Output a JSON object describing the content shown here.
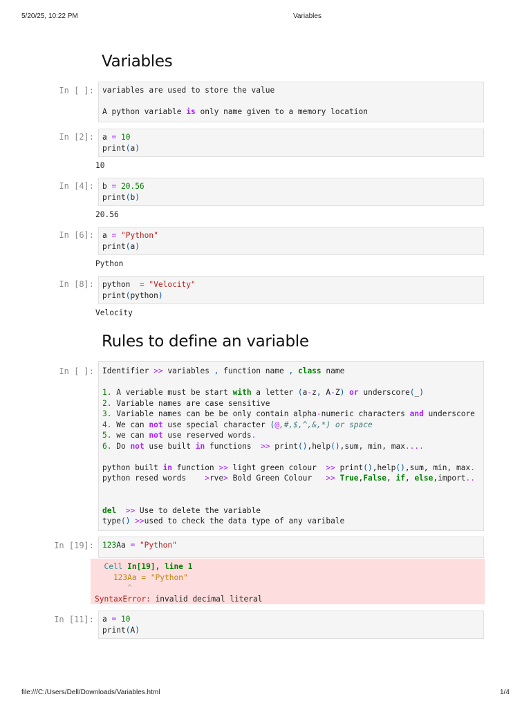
{
  "print_header": {
    "datetime": "5/20/25, 10:22 PM",
    "title": "Variables"
  },
  "print_footer": {
    "path": "file:///C:/Users/Dell/Downloads/Variables.html",
    "page": "1/4"
  },
  "headings": [
    "Variables",
    "Rules to define an variable"
  ],
  "cells": [
    {
      "prompt": "In [ ]:",
      "lines": [
        [
          [
            "variables are used to store the value",
            ""
          ]
        ],
        [],
        [
          [
            "A python variable ",
            ""
          ],
          [
            "is",
            "ob"
          ],
          [
            " only name given to a memory location",
            ""
          ]
        ]
      ]
    },
    {
      "prompt": "In [2]:",
      "lines": [
        [
          [
            "a ",
            ""
          ],
          [
            "=",
            "o"
          ],
          [
            " ",
            ""
          ],
          [
            "10",
            "n"
          ]
        ],
        [
          [
            "print",
            ""
          ],
          [
            "(",
            "p"
          ],
          [
            "a",
            ""
          ],
          [
            ")",
            "p"
          ]
        ]
      ],
      "output": "10"
    },
    {
      "prompt": "In [4]:",
      "lines": [
        [
          [
            "b ",
            ""
          ],
          [
            "=",
            "o"
          ],
          [
            " ",
            ""
          ],
          [
            "20.56",
            "n"
          ]
        ],
        [
          [
            "print",
            ""
          ],
          [
            "(",
            "p"
          ],
          [
            "b",
            ""
          ],
          [
            ")",
            "p"
          ]
        ]
      ],
      "output": "20.56"
    },
    {
      "prompt": "In [6]:",
      "lines": [
        [
          [
            "a ",
            ""
          ],
          [
            "=",
            "o"
          ],
          [
            " ",
            ""
          ],
          [
            "\"Python\"",
            "s"
          ]
        ],
        [
          [
            "print",
            ""
          ],
          [
            "(",
            "p"
          ],
          [
            "a",
            ""
          ],
          [
            ")",
            "p"
          ]
        ]
      ],
      "output": "Python"
    },
    {
      "prompt": "In [8]:",
      "lines": [
        [
          [
            "python  ",
            ""
          ],
          [
            "=",
            "o"
          ],
          [
            " ",
            ""
          ],
          [
            "\"Velocity\"",
            "s"
          ]
        ],
        [
          [
            "print",
            ""
          ],
          [
            "(",
            "p"
          ],
          [
            "python",
            ""
          ],
          [
            ")",
            "p"
          ]
        ]
      ],
      "output": "Velocity"
    },
    {
      "prompt": "In [ ]:",
      "lines": [
        [
          [
            "Identifier ",
            ""
          ],
          [
            ">>",
            "o"
          ],
          [
            " variables ",
            ""
          ],
          [
            ",",
            "p"
          ],
          [
            " function name ",
            ""
          ],
          [
            ",",
            "p"
          ],
          [
            " ",
            ""
          ],
          [
            "class",
            "k"
          ],
          [
            " name",
            ""
          ]
        ],
        [],
        [
          [
            "1.",
            "n"
          ],
          [
            " A veriable must be start ",
            ""
          ],
          [
            "with",
            "k"
          ],
          [
            " a letter ",
            ""
          ],
          [
            "(",
            "p"
          ],
          [
            "a",
            ""
          ],
          [
            "-",
            "o"
          ],
          [
            "z",
            ""
          ],
          [
            ",",
            "p"
          ],
          [
            " A",
            ""
          ],
          [
            "-",
            "o"
          ],
          [
            "Z",
            ""
          ],
          [
            ")",
            "p"
          ],
          [
            " ",
            ""
          ],
          [
            "or",
            "ob"
          ],
          [
            " underscore",
            ""
          ],
          [
            "(",
            "p"
          ],
          [
            "_",
            ""
          ],
          [
            ")",
            "p"
          ]
        ],
        [
          [
            "2.",
            "n"
          ],
          [
            " Variable names are case sensitive",
            ""
          ]
        ],
        [
          [
            "3.",
            "n"
          ],
          [
            " Variable names can be be only contain alpha",
            ""
          ],
          [
            "-",
            "o"
          ],
          [
            "numeric characters ",
            ""
          ],
          [
            "and",
            "ob"
          ],
          [
            " underscore",
            ""
          ]
        ],
        [
          [
            "4.",
            "n"
          ],
          [
            " We can ",
            ""
          ],
          [
            "not",
            "ob"
          ],
          [
            " use special character ",
            ""
          ],
          [
            "(",
            "p"
          ],
          [
            "@",
            "o"
          ],
          [
            ",#,$,^,&,*) or space",
            "i"
          ]
        ],
        [
          [
            "5.",
            "n"
          ],
          [
            " we can ",
            ""
          ],
          [
            "not",
            "ob"
          ],
          [
            " use reserved words",
            ""
          ],
          [
            ".",
            "o"
          ]
        ],
        [
          [
            "6.",
            "n"
          ],
          [
            " Do ",
            ""
          ],
          [
            "not",
            "ob"
          ],
          [
            " use built ",
            ""
          ],
          [
            "in",
            "ob"
          ],
          [
            " functions  ",
            ""
          ],
          [
            ">>",
            "o"
          ],
          [
            " print",
            ""
          ],
          [
            "()",
            "p"
          ],
          [
            ",help",
            ""
          ],
          [
            "()",
            "p"
          ],
          [
            ",sum, min, max",
            ""
          ],
          [
            "....",
            "o"
          ]
        ],
        [],
        [
          [
            "python built ",
            ""
          ],
          [
            "in",
            "ob"
          ],
          [
            " function ",
            ""
          ],
          [
            ">>",
            "o"
          ],
          [
            " light green colour  ",
            ""
          ],
          [
            ">>",
            "o"
          ],
          [
            " print",
            ""
          ],
          [
            "()",
            "p"
          ],
          [
            ",help",
            ""
          ],
          [
            "()",
            "p"
          ],
          [
            ",sum, min, max",
            ""
          ],
          [
            ".",
            "o"
          ]
        ],
        [
          [
            "python resed words    ",
            ""
          ],
          [
            ">",
            "o"
          ],
          [
            "rve",
            ""
          ],
          [
            ">",
            "o"
          ],
          [
            " Bold Green Colour   ",
            ""
          ],
          [
            ">>",
            "o"
          ],
          [
            " ",
            ""
          ],
          [
            "True",
            "k"
          ],
          [
            ",",
            ""
          ],
          [
            "False",
            "k"
          ],
          [
            ", ",
            ""
          ],
          [
            "if",
            "k"
          ],
          [
            ", ",
            ""
          ],
          [
            "else",
            "k"
          ],
          [
            ",import",
            ""
          ],
          [
            "..",
            "o"
          ]
        ],
        [],
        [],
        [
          [
            "del",
            "k"
          ],
          [
            "  ",
            ""
          ],
          [
            ">>",
            "o"
          ],
          [
            " Use to delete the variable",
            ""
          ]
        ],
        [
          [
            "type",
            ""
          ],
          [
            "()",
            "p"
          ],
          [
            " ",
            ""
          ],
          [
            ">>",
            "o"
          ],
          [
            "used to check the data type of any varibale",
            ""
          ]
        ]
      ]
    },
    {
      "prompt": "In [19]:",
      "lines": [
        [
          [
            "123",
            "n"
          ],
          [
            "Aa ",
            ""
          ],
          [
            "=",
            "o"
          ],
          [
            " ",
            ""
          ],
          [
            "\"Python\"",
            "s"
          ]
        ]
      ],
      "error": {
        "lines": [
          [
            [
              "  Cell ",
              "c"
            ],
            [
              "In[19], line 1",
              "g"
            ]
          ],
          [
            [
              "    123Aa = \"Python\"",
              "y"
            ]
          ],
          [
            [
              "       ^",
              "f"
            ]
          ],
          [
            [
              "SyntaxError:",
              "r"
            ],
            [
              " invalid decimal literal",
              ""
            ]
          ]
        ]
      }
    },
    {
      "prompt": "In [11]:",
      "lines": [
        [
          [
            "a ",
            ""
          ],
          [
            "=",
            "o"
          ],
          [
            " ",
            ""
          ],
          [
            "10",
            "n"
          ]
        ],
        [
          [
            "print",
            ""
          ],
          [
            "(",
            "p"
          ],
          [
            "A",
            ""
          ],
          [
            ")",
            "p"
          ]
        ]
      ]
    }
  ]
}
